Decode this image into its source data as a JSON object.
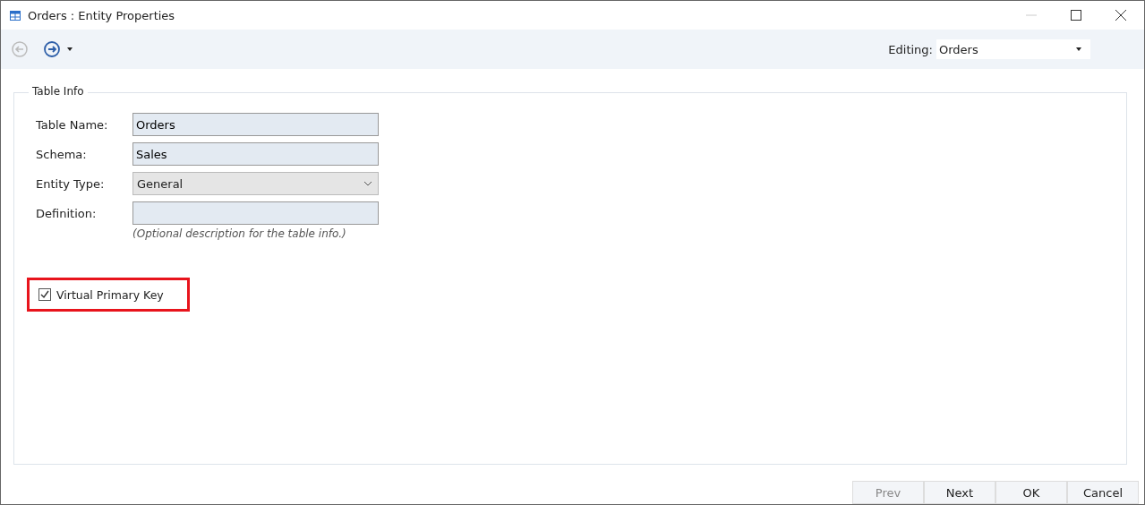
{
  "window": {
    "title": "Orders : Entity Properties"
  },
  "toolbar": {
    "back": {
      "disabled": true
    },
    "forward": {
      "disabled": false
    },
    "editing": {
      "label": "Editing:",
      "value": "Orders"
    }
  },
  "group": {
    "title": "Table Info",
    "fields": [
      {
        "kind": "text",
        "label": "Table Name:",
        "value": "Orders"
      },
      {
        "kind": "text",
        "label": "Schema:",
        "value": "Sales"
      },
      {
        "kind": "select",
        "label": "Entity Type:",
        "value": "General"
      },
      {
        "kind": "text",
        "label": "Definition:",
        "hint": "(Optional description for the table info.)"
      }
    ],
    "checkbox": {
      "label": "Virtual Primary Key",
      "checked": true,
      "highlighted": true
    }
  },
  "buttons": [
    {
      "label": "Prev",
      "disabled": true
    },
    {
      "label": "Next",
      "disabled": false
    },
    {
      "label": "OK",
      "disabled": false
    },
    {
      "label": "Cancel",
      "disabled": false
    }
  ]
}
